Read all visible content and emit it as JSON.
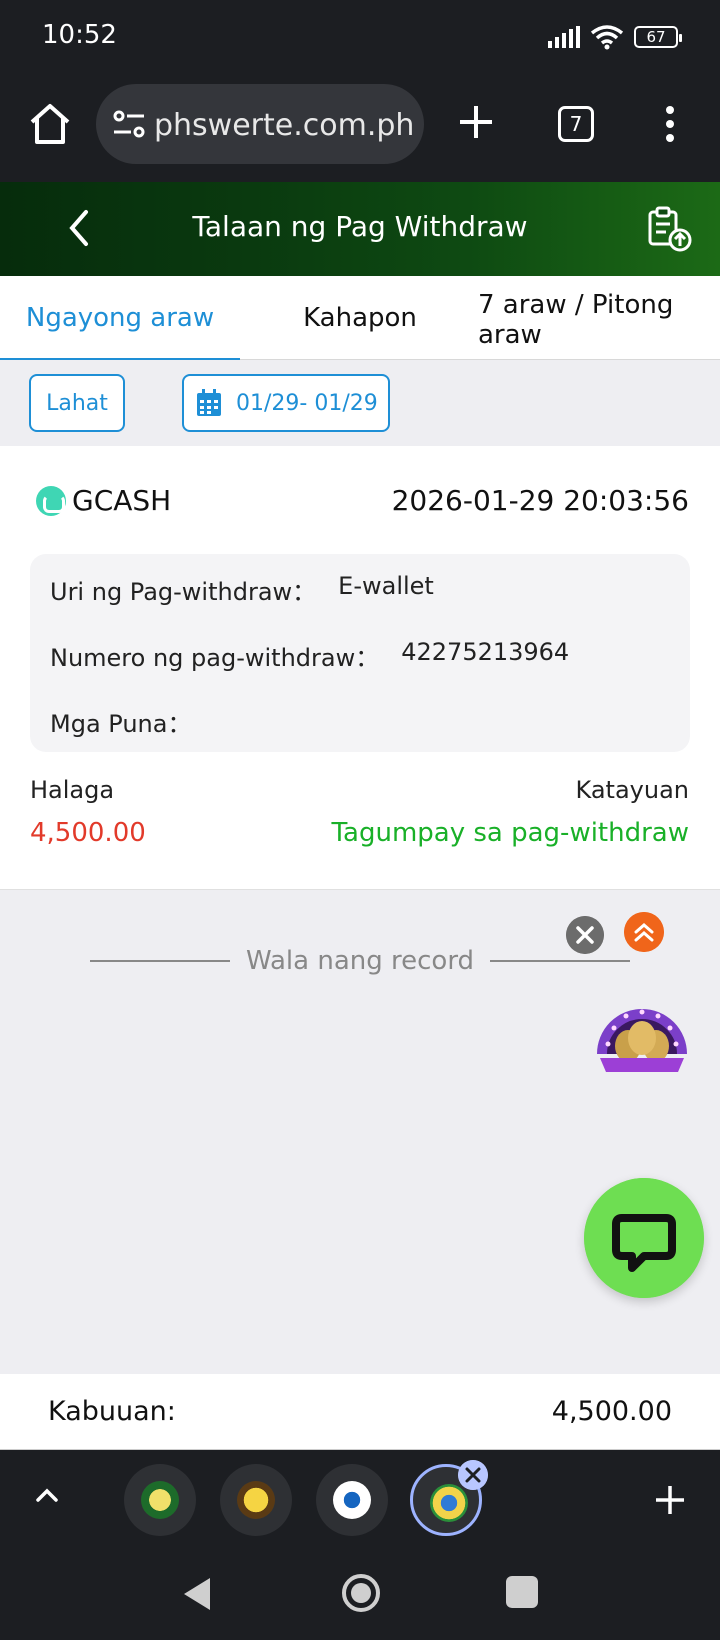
{
  "status_bar": {
    "time": "10:52",
    "battery": "67"
  },
  "browser": {
    "url": "phswerte.com.ph",
    "tab_count": "7"
  },
  "header": {
    "title": "Talaan ng Pag Withdraw"
  },
  "tabs": [
    {
      "label": "Ngayong araw",
      "active": true
    },
    {
      "label": "Kahapon",
      "active": false
    },
    {
      "label": "7 araw / Pitong araw",
      "active": false
    }
  ],
  "filters": {
    "all_label": "Lahat",
    "date_range": "01/29- 01/29"
  },
  "record": {
    "method": "GCASH",
    "datetime": "2026-01-29 20:03:56",
    "details": [
      {
        "label": "Uri ng Pag-withdraw：",
        "value": "E-wallet"
      },
      {
        "label": "Numero ng pag-withdraw：",
        "value": "42275213964"
      },
      {
        "label": "Mga Puna：",
        "value": ""
      }
    ],
    "amount_label": "Halaga",
    "amount": "4,500.00",
    "status_label": "Katayuan",
    "status": "Tagumpay sa pag-withdraw"
  },
  "empty": {
    "message": "Wala nang record"
  },
  "total": {
    "label": "Kabuuan:",
    "value": "4,500.00"
  },
  "colors": {
    "accent": "#1e8fd6",
    "amount": "#e23a2a",
    "success": "#19b028",
    "chat": "#6ede52"
  }
}
